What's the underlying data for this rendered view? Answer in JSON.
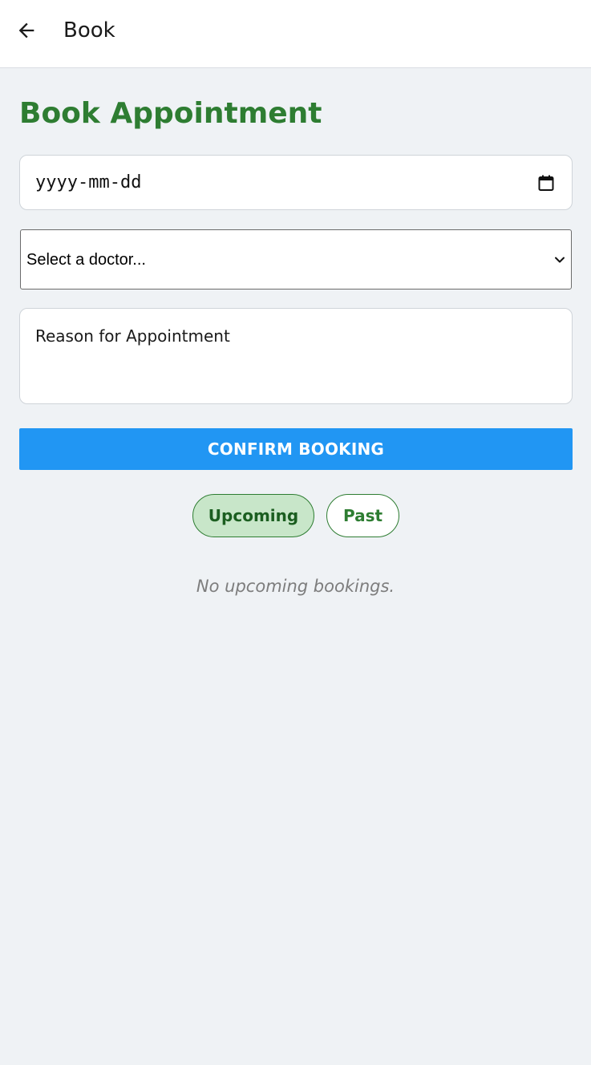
{
  "app_bar": {
    "back_icon": "arrow-left-icon",
    "title": "Book"
  },
  "page": {
    "title": "Book Appointment"
  },
  "form": {
    "date": {
      "placeholder": "yyyy-mm-dd",
      "icon": "calendar-icon"
    },
    "doctor_select": {
      "selected": "Select a doctor...",
      "icon": "chevron-down-icon"
    },
    "reason": {
      "placeholder": "Reason for Appointment"
    },
    "confirm_label": "CONFIRM BOOKING"
  },
  "tabs": [
    {
      "label": "Upcoming",
      "active": true
    },
    {
      "label": "Past",
      "active": false
    }
  ],
  "empty_message": "No upcoming bookings.",
  "colors": {
    "accent_green": "#2e7d32",
    "button_blue": "#2196f3",
    "active_pill_bg": "#c8e6c9",
    "background": "#eff2f5"
  }
}
